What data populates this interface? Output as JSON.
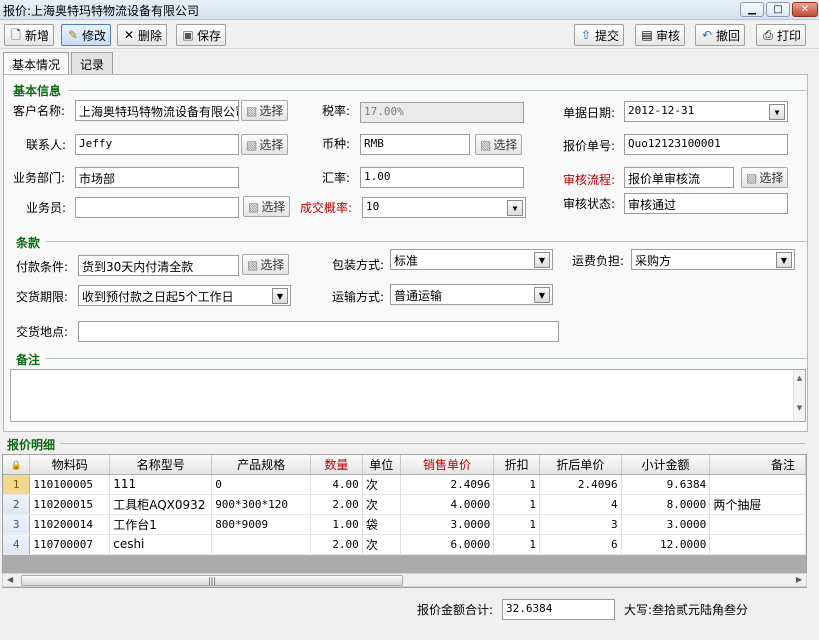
{
  "window": {
    "title": "报价:上海奥特玛特物流设备有限公司",
    "min": "▁",
    "max": "□",
    "close": "✕"
  },
  "toolbar": {
    "new": "新增",
    "edit": "修改",
    "delete": "删除",
    "save": "保存",
    "submit": "提交",
    "audit": "审核",
    "revoke": "撤回",
    "print": "打印"
  },
  "tabs": {
    "basic": "基本情况",
    "records": "记录"
  },
  "basic": {
    "section_title": "基本信息",
    "customer_label": "客户名称:",
    "customer_value": "上海奥特玛特物流设备有限公司",
    "contact_label": "联系人:",
    "contact_value": "Jeffy",
    "dept_label": "业务部门:",
    "dept_value": "市场部",
    "salesman_label": "业务员:",
    "salesman_value": "",
    "tax_label": "税率:",
    "tax_value": "17.00%",
    "currency_label": "币种:",
    "currency_value": "RMB",
    "rate_label": "汇率:",
    "rate_value": "1.00",
    "prob_label": "成交概率:",
    "prob_value": "10",
    "date_label": "单据日期:",
    "date_value": "2012-12-31",
    "quote_no_label": "报价单号:",
    "quote_no_value": "Quo12123100001",
    "flow_label": "审核流程:",
    "flow_value": "报价单审核流",
    "status_label": "审核状态:",
    "status_value": "审核通过",
    "select_label": "选择"
  },
  "terms": {
    "section_title": "条款",
    "payment_label": "付款条件:",
    "payment_value": "货到30天内付清全款",
    "delivery_term_label": "交货期限:",
    "delivery_term_value": "收到预付款之日起5个工作日",
    "delivery_place_label": "交货地点:",
    "delivery_place_value": "",
    "packing_label": "包装方式:",
    "packing_value": "标准",
    "transport_label": "运输方式:",
    "transport_value": "普通运输",
    "freight_label": "运费负担:",
    "freight_value": "采购方"
  },
  "remarks": {
    "section_title": "备注",
    "value": ""
  },
  "detail": {
    "section_title": "报价明细",
    "headers": [
      "物料码",
      "名称型号",
      "产品规格",
      "数量",
      "单位",
      "销售单价",
      "折扣",
      "折后单价",
      "小计金额",
      "备注"
    ],
    "rows": [
      [
        "1",
        "110100005",
        "111",
        "0",
        "4.00",
        "次",
        "2.4096",
        "1",
        "2.4096",
        "9.6384",
        ""
      ],
      [
        "2",
        "110200015",
        "工具柜AQX0932",
        "900*300*120",
        "2.00",
        "次",
        "4.0000",
        "1",
        "4",
        "8.0000",
        "两个抽屉"
      ],
      [
        "3",
        "110200014",
        "工作台1",
        "800*9009",
        "1.00",
        "袋",
        "3.0000",
        "1",
        "3",
        "3.0000",
        ""
      ],
      [
        "4",
        "110700007",
        "ceshi",
        "",
        "2.00",
        "次",
        "6.0000",
        "1",
        "6",
        "12.0000",
        ""
      ]
    ]
  },
  "footer": {
    "total_label": "报价金额合计:",
    "total_value": "32.6384",
    "upper_label": "大写:",
    "upper_value": "叁拾贰元陆角叁分"
  },
  "colors": {
    "section_green": "#0c6b14",
    "required_red": "#c00000",
    "current_row": "#f3d98e"
  }
}
